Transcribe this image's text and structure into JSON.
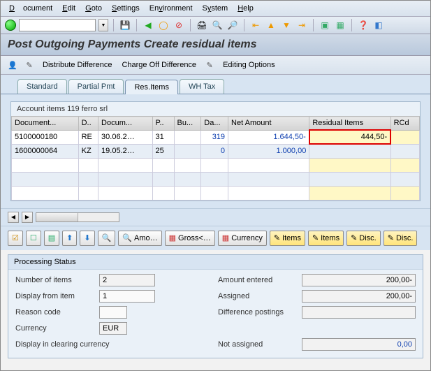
{
  "menu": {
    "document": "Document",
    "edit": "Edit",
    "goto": "Goto",
    "settings": "Settings",
    "environment": "Environment",
    "system": "System",
    "help": "Help"
  },
  "title": "Post Outgoing Payments Create residual items",
  "apptoolbar": {
    "distribute": "Distribute Difference",
    "chargeoff": "Charge Off Difference",
    "editopts": "Editing Options"
  },
  "tabs": {
    "standard": "Standard",
    "partial": "Partial Pmt",
    "res": "Res.Items",
    "wh": "WH Tax"
  },
  "section_title": "Account items 119 ferro srl",
  "columns": [
    "Document...",
    "D..",
    "Docum...",
    "P..",
    "Bu...",
    "Da...",
    "Net Amount",
    "Residual Items",
    "RCd"
  ],
  "rows": [
    {
      "doc": "5100000180",
      "dt": "RE",
      "date": "30.06.2…",
      "pk": "31",
      "ba": "",
      "da": "319",
      "net": "1.644,50-",
      "res": "444,50-",
      "rcd": ""
    },
    {
      "doc": "1600000064",
      "dt": "KZ",
      "date": "19.05.2…",
      "pk": "25",
      "ba": "",
      "da": "0",
      "net": "1.000,00",
      "res": "",
      "rcd": ""
    }
  ],
  "buttons": {
    "amo": "Amo…",
    "gross": "Gross<…",
    "currency": "Currency",
    "items": "Items",
    "disc": "Disc."
  },
  "proc": {
    "title": "Processing Status",
    "num_items_l": "Number of items",
    "num_items_v": "2",
    "disp_from_l": "Display from item",
    "disp_from_v": "1",
    "reason_l": "Reason code",
    "reason_v": "",
    "currency_l": "Currency",
    "currency_v": "EUR",
    "disp_clear_l": "Display in clearing currency",
    "amt_l": "Amount entered",
    "amt_v": "200,00-",
    "ass_l": "Assigned",
    "ass_v": "200,00-",
    "diff_l": "Difference postings",
    "diff_v": "",
    "notass_l": "Not assigned",
    "notass_v": "0,00"
  }
}
